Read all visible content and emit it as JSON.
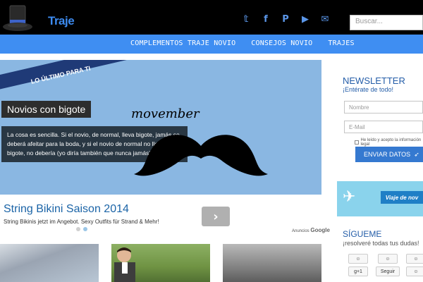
{
  "header": {
    "logo_text": "Traje",
    "search_placeholder": "Buscar...",
    "social_icons": [
      "twitter-icon",
      "facebook-icon",
      "pinterest-icon",
      "youtube-icon",
      "email-icon"
    ]
  },
  "nav": {
    "items": [
      "COMPLEMENTOS TRAJE NOVIO",
      "CONSEJOS NOVIO",
      "TRAJES"
    ]
  },
  "hero": {
    "ribbon": "LO ÚLTIMO PARA TI",
    "title": "Novios con bigote",
    "text": "La cosa es sencilla. Si el novio, de normal, lleva bigote, jamás se deberá afeitar para la boda, y si el novio de normal no lleva bigote, no debería (yo diría también que nunca jamás)...",
    "movember": "movember"
  },
  "ad": {
    "title": "String Bikini Saison 2014",
    "subtitle": "String Bikinis jetzt im Angebot. Sexy Outfits für Strand & Mehr!",
    "google_label": "Anuncios",
    "google_brand": "Google"
  },
  "sidebar": {
    "newsletter_title": "NEWSLETTER",
    "newsletter_sub": "¡Entérate de todo!",
    "name_placeholder": "Nombre",
    "email_placeholder": "E-Mail",
    "consent_text": "He leído y acepto la información legal",
    "send_label": "ENVIAR DATOS",
    "banner_text": "Viaje de nov",
    "follow_title": "SÍGUEME",
    "follow_sub": "¡resolveré todas tus dudas!",
    "share_plusone": "g+1",
    "share_follow": "Seguir"
  },
  "colors": {
    "accent": "#3f8ef2",
    "hero_bg": "#8ab7e2",
    "sidebar_text": "#245da8"
  }
}
